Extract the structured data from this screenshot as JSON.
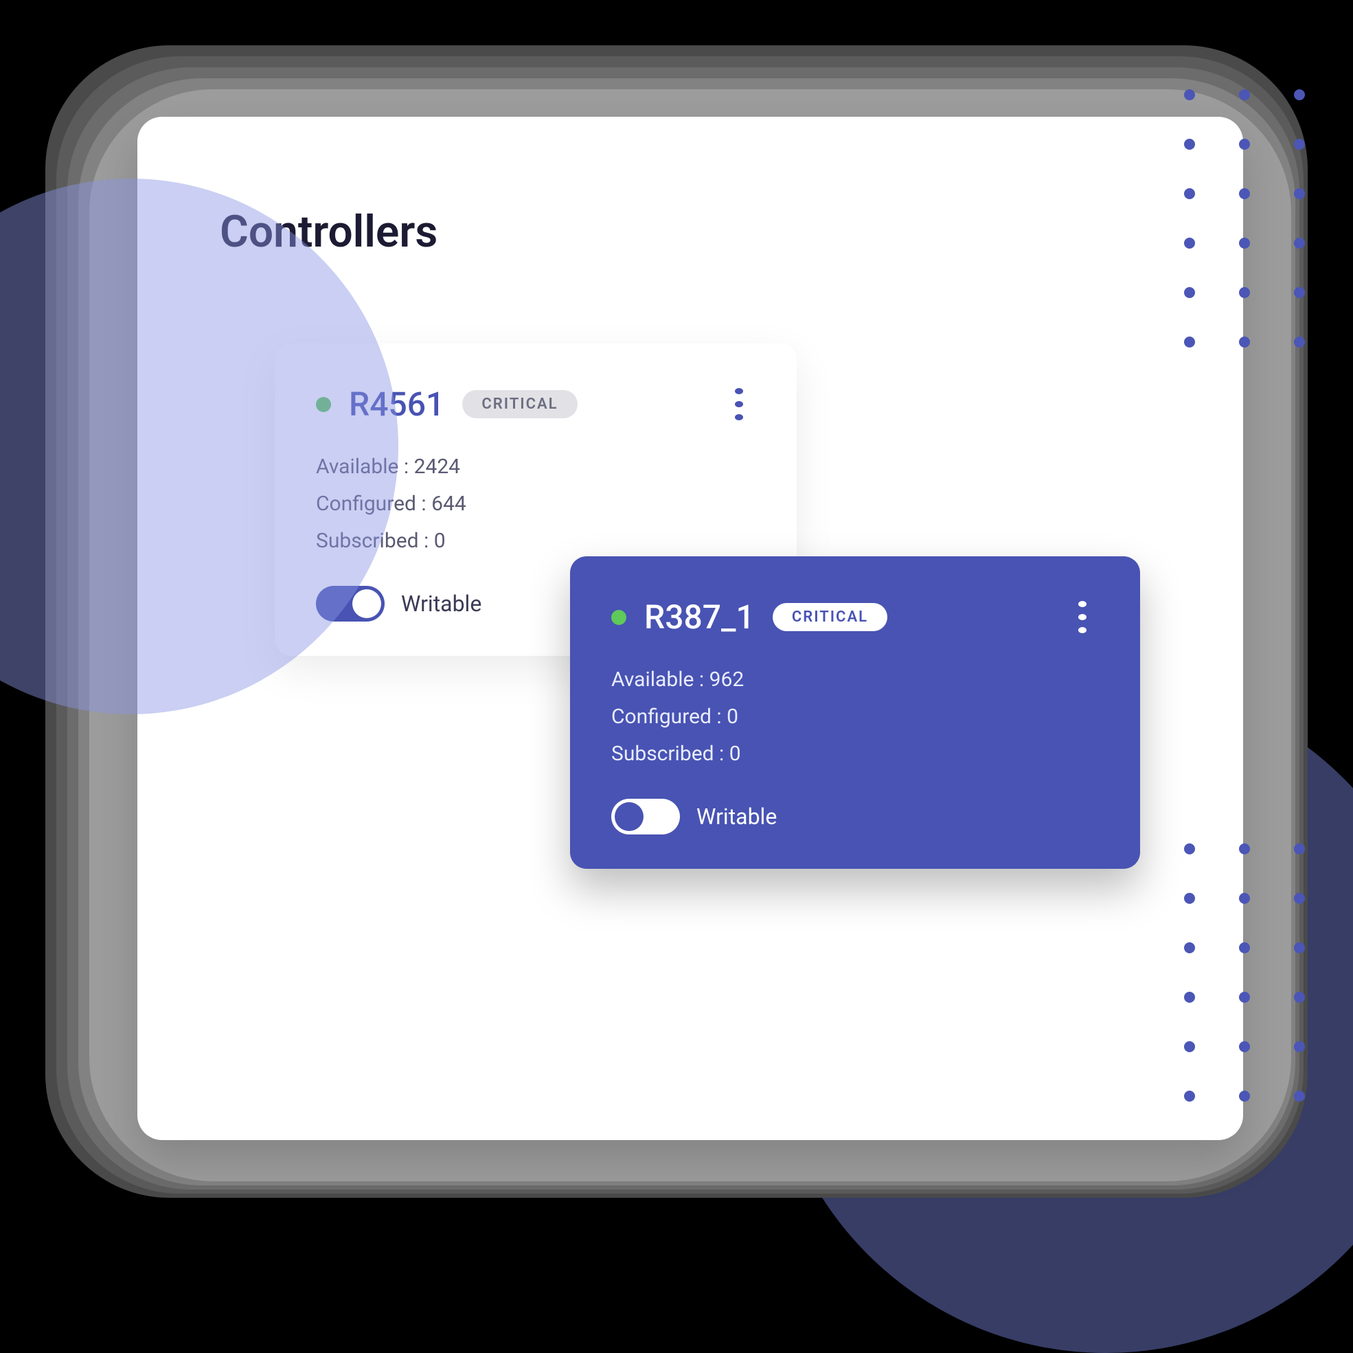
{
  "page": {
    "title": "Controllers"
  },
  "labels": {
    "available": "Available",
    "configured": "Configured",
    "subscribed": "Subscribed",
    "writable": "Writable",
    "sep": " : "
  },
  "controllers": [
    {
      "id": "R4561",
      "badge": "CRITICAL",
      "status_color": "#5fc95a",
      "available": 2424,
      "configured": 644,
      "subscribed": 0,
      "writable": true,
      "variant": "light"
    },
    {
      "id": "R387_1",
      "badge": "CRITICAL",
      "status_color": "#5fc95a",
      "available": 962,
      "configured": 0,
      "subscribed": 0,
      "writable": false,
      "variant": "dark"
    }
  ],
  "colors": {
    "accent": "#4853b3",
    "status_ok": "#5fc95a",
    "text_primary": "#1c1b33",
    "text_secondary": "#5b5a73"
  }
}
